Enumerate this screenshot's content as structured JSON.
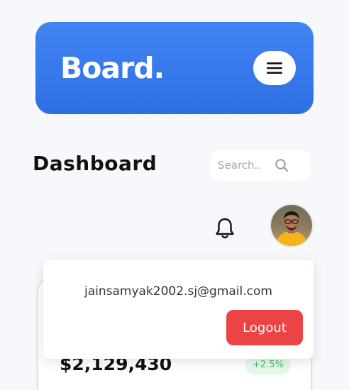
{
  "header": {
    "brand": "Board.",
    "menu_icon": "hamburger-menu-icon"
  },
  "main": {
    "title": "Dashboard",
    "search": {
      "placeholder": "Search..",
      "icon": "search-icon"
    },
    "notifications_icon": "bell-icon",
    "avatar": "user-avatar"
  },
  "card": {
    "amount": "$2,129,430",
    "change": "+2.5%"
  },
  "profile_popup": {
    "email": "jainsamyak2002.sj@gmail.com",
    "logout_label": "Logout"
  },
  "colors": {
    "header_bg": "#3b7cf0",
    "logout_bg": "#ec4444",
    "badge_bg": "#e6f8ea",
    "badge_text": "#48c06a",
    "page_bg": "#f7f8fc"
  }
}
